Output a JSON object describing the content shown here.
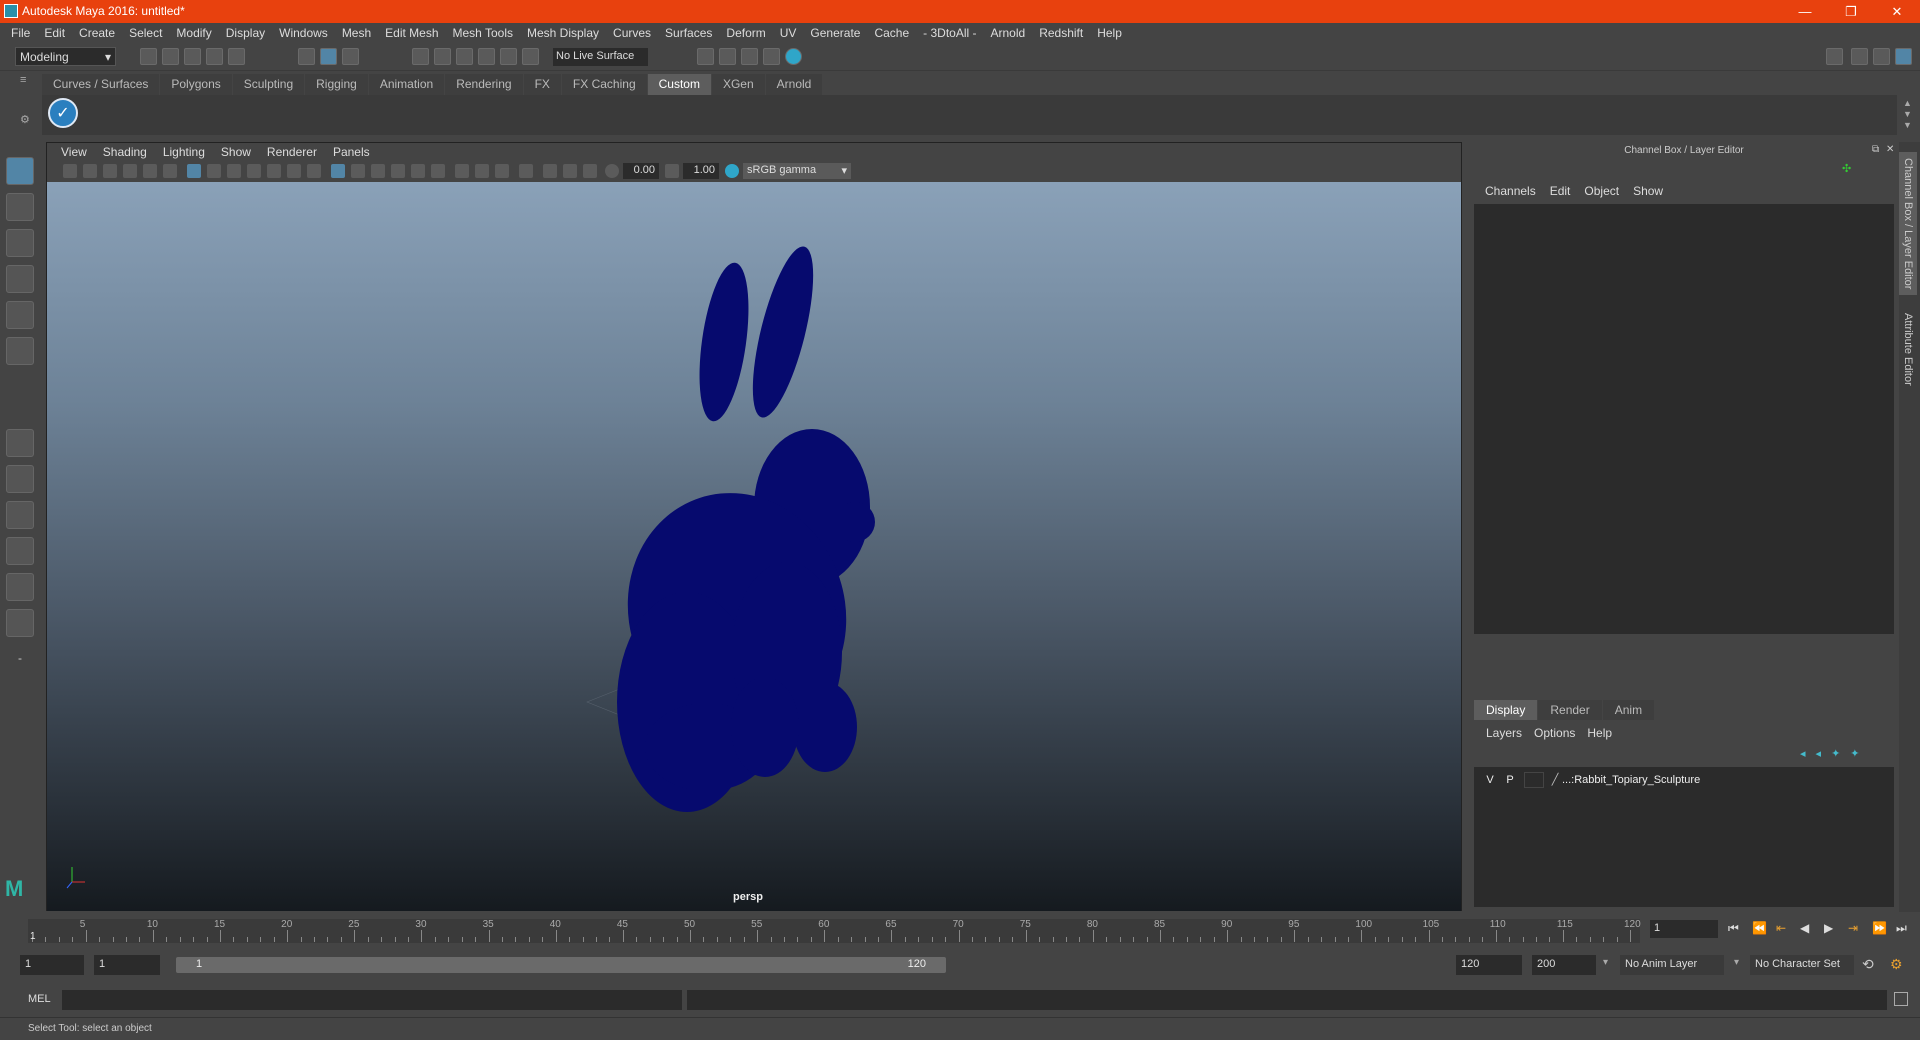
{
  "window": {
    "title": "Autodesk Maya 2016: untitled*",
    "minimize": "—",
    "restore": "❐",
    "close": "✕"
  },
  "menus": [
    "File",
    "Edit",
    "Create",
    "Select",
    "Modify",
    "Display",
    "Windows",
    "Mesh",
    "Edit Mesh",
    "Mesh Tools",
    "Mesh Display",
    "Curves",
    "Surfaces",
    "Deform",
    "UV",
    "Generate",
    "Cache",
    "- 3DtoAll -",
    "Arnold",
    "Redshift",
    "Help"
  ],
  "status": {
    "mode": "Modeling",
    "live_surface": "No Live Surface"
  },
  "shelf": {
    "tabs": [
      "Curves / Surfaces",
      "Polygons",
      "Sculpting",
      "Rigging",
      "Animation",
      "Rendering",
      "FX",
      "FX Caching",
      "Custom",
      "XGen",
      "Arnold"
    ],
    "active": "Custom"
  },
  "viewport": {
    "menus": [
      "View",
      "Shading",
      "Lighting",
      "Show",
      "Renderer",
      "Panels"
    ],
    "exposure": "0.00",
    "gamma": "1.00",
    "color_space": "sRGB gamma",
    "camera_label": "persp",
    "object_color": "#060a6e"
  },
  "channelbox": {
    "title": "Channel Box / Layer Editor",
    "menus": [
      "Channels",
      "Edit",
      "Object",
      "Show"
    ],
    "layer_tabs": [
      "Display",
      "Render",
      "Anim"
    ],
    "layer_active": "Display",
    "layer_menus": [
      "Layers",
      "Options",
      "Help"
    ],
    "layer": {
      "v": "V",
      "p": "P",
      "name": "...:Rabbit_Topiary_Sculpture"
    }
  },
  "sidetabs": {
    "channel": "Channel Box / Layer Editor",
    "attr": "Attribute Editor"
  },
  "timeline": {
    "ticks": [
      1,
      5,
      10,
      15,
      20,
      25,
      30,
      35,
      40,
      45,
      50,
      55,
      60,
      65,
      70,
      75,
      80,
      85,
      90,
      95,
      100,
      105,
      110,
      115,
      120
    ],
    "current": "1",
    "current_field": "1"
  },
  "range": {
    "start": "1",
    "anim_start": "1",
    "slider_start": "1",
    "slider_end": "120",
    "end": "120",
    "anim_end": "200",
    "anim_layer": "No Anim Layer",
    "char_set": "No Character Set"
  },
  "cmd": {
    "label": "MEL"
  },
  "help": {
    "text": "Select Tool: select an object"
  }
}
